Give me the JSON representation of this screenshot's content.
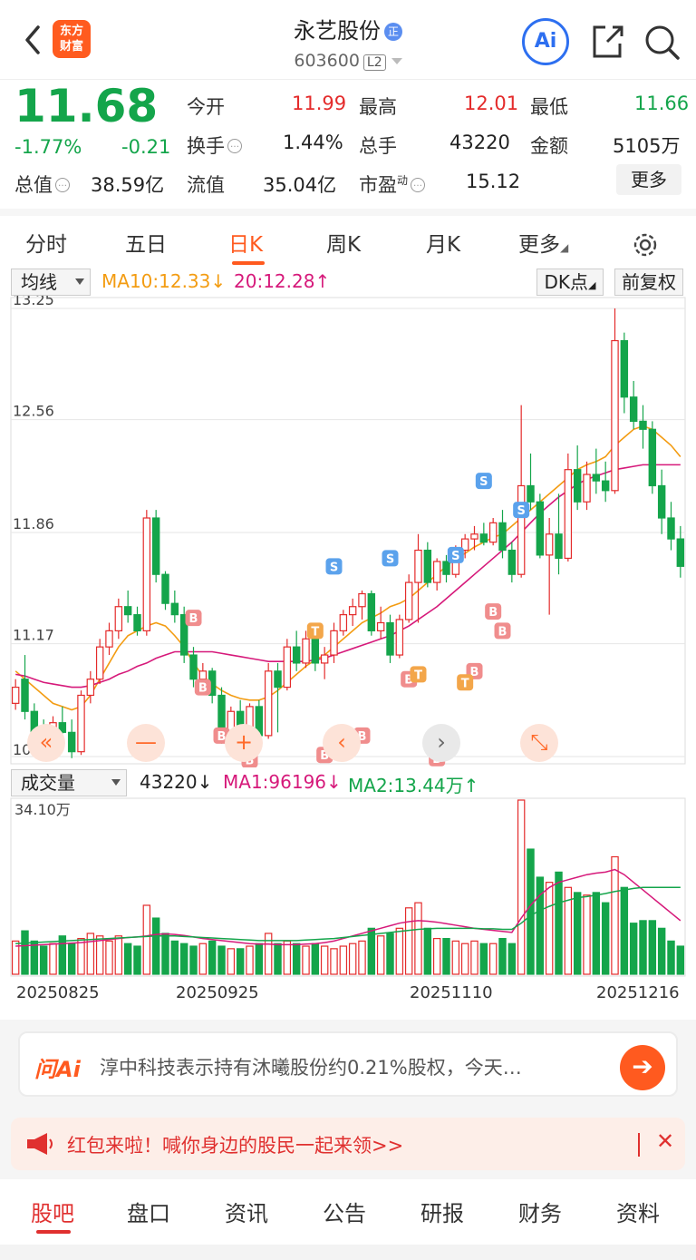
{
  "header": {
    "logo_text": "东方\n财富",
    "title": "永艺股份",
    "title_badge": "正",
    "code": "603600",
    "level": "L2",
    "ai_label": "Ai"
  },
  "quote": {
    "price": "11.68",
    "change_pct": "-1.77%",
    "change_abs": "-0.21",
    "open_label": "今开",
    "open": "11.99",
    "high_label": "最高",
    "high": "12.01",
    "low_label": "最低",
    "low": "11.66",
    "turnover_label": "换手",
    "turnover": "1.44%",
    "volume_label": "总手",
    "volume": "43220",
    "amount_label": "金额",
    "amount": "5105万",
    "mcap_label": "总值",
    "mcap": "38.59亿",
    "float_label": "流值",
    "float_mcap": "35.04亿",
    "pe_label": "市盈",
    "pe_sup": "动",
    "pe": "15.12",
    "more": "更多"
  },
  "tabs": [
    "分时",
    "五日",
    "日K",
    "周K",
    "月K",
    "更多"
  ],
  "active_tab": "日K",
  "kline": {
    "indicator": "均线",
    "ma10": "MA10:12.33↓",
    "ma20": "20:12.28↑",
    "dk_label": "DK点",
    "adjust_label": "前复权",
    "y_ticks": [
      "13.25",
      "12.56",
      "11.86",
      "11.17",
      "10.47"
    ]
  },
  "volume": {
    "indicator": "成交量",
    "value": "43220↓",
    "ma1": "MA1:96196↓",
    "ma2": "MA2:13.44万↑",
    "max_label": "34.10万"
  },
  "dates": [
    "20250825",
    "20250925",
    "20251110",
    "20251216"
  ],
  "controls": [
    "«",
    "—",
    "+",
    "‹",
    "›",
    "⤡"
  ],
  "ai": {
    "logo": "问Ai",
    "text": "淳中科技表示持有沐曦股份约0.21%股权，今天…"
  },
  "promo": {
    "text": "红包来啦！喊你身边的股民一起来领>>"
  },
  "bottom_tabs": [
    "股吧",
    "盘口",
    "资讯",
    "公告",
    "研报",
    "财务",
    "资料"
  ],
  "colors": {
    "up": "#e42b2b",
    "down": "#14a54b",
    "accent": "#ff5a1f",
    "ma10": "#f39c12",
    "ma20": "#d6197a"
  },
  "chart_data": {
    "type": "candlestick",
    "ylim": [
      10.47,
      13.25
    ],
    "y_ticks": [
      13.25,
      12.56,
      11.86,
      11.17,
      10.47
    ],
    "x_labels": [
      "20250825",
      "20250925",
      "20251110",
      "20251216"
    ],
    "candles": [
      [
        10.8,
        10.95,
        10.76,
        10.9
      ],
      [
        10.95,
        11.1,
        10.7,
        10.75
      ],
      [
        10.75,
        10.8,
        10.55,
        10.6
      ],
      [
        10.6,
        10.7,
        10.45,
        10.5
      ],
      [
        10.5,
        10.72,
        10.47,
        10.68
      ],
      [
        10.68,
        10.78,
        10.55,
        10.62
      ],
      [
        10.62,
        10.7,
        10.46,
        10.5
      ],
      [
        10.5,
        10.88,
        10.48,
        10.85
      ],
      [
        10.85,
        11.0,
        10.8,
        10.95
      ],
      [
        10.95,
        11.2,
        10.92,
        11.15
      ],
      [
        11.15,
        11.3,
        11.1,
        11.25
      ],
      [
        11.25,
        11.45,
        11.2,
        11.4
      ],
      [
        11.4,
        11.5,
        11.3,
        11.35
      ],
      [
        11.35,
        11.4,
        11.22,
        11.25
      ],
      [
        11.25,
        12.0,
        11.22,
        11.95
      ],
      [
        11.95,
        12.0,
        11.55,
        11.6
      ],
      [
        11.6,
        11.62,
        11.38,
        11.42
      ],
      [
        11.42,
        11.5,
        11.3,
        11.35
      ],
      [
        11.35,
        11.4,
        11.05,
        11.1
      ],
      [
        11.1,
        11.15,
        10.9,
        10.95
      ],
      [
        10.95,
        11.05,
        10.85,
        11.0
      ],
      [
        11.0,
        11.02,
        10.8,
        10.85
      ],
      [
        10.85,
        10.9,
        10.55,
        10.6
      ],
      [
        10.6,
        10.78,
        10.55,
        10.75
      ],
      [
        10.75,
        10.82,
        10.6,
        10.65
      ],
      [
        10.65,
        10.8,
        10.62,
        10.78
      ],
      [
        10.78,
        10.82,
        10.55,
        10.6
      ],
      [
        10.6,
        11.05,
        10.58,
        11.0
      ],
      [
        11.0,
        11.05,
        10.62,
        10.9
      ],
      [
        10.9,
        11.2,
        10.88,
        11.15
      ],
      [
        11.15,
        11.25,
        11.0,
        11.05
      ],
      [
        11.05,
        11.25,
        11.02,
        11.2
      ],
      [
        11.2,
        11.22,
        11.0,
        11.05
      ],
      [
        11.05,
        11.15,
        10.95,
        11.1
      ],
      [
        11.1,
        11.3,
        11.05,
        11.25
      ],
      [
        11.25,
        11.38,
        11.22,
        11.35
      ],
      [
        11.35,
        11.45,
        11.28,
        11.4
      ],
      [
        11.4,
        11.5,
        11.32,
        11.48
      ],
      [
        11.48,
        11.5,
        11.22,
        11.25
      ],
      [
        11.25,
        11.4,
        11.2,
        11.3
      ],
      [
        11.3,
        11.35,
        11.05,
        11.1
      ],
      [
        11.1,
        11.35,
        11.08,
        11.32
      ],
      [
        11.32,
        11.6,
        11.3,
        11.55
      ],
      [
        11.55,
        11.85,
        11.3,
        11.75
      ],
      [
        11.75,
        11.8,
        11.52,
        11.55
      ],
      [
        11.55,
        11.7,
        11.5,
        11.68
      ],
      [
        11.68,
        11.72,
        11.55,
        11.6
      ],
      [
        11.6,
        11.78,
        11.58,
        11.75
      ],
      [
        11.75,
        11.85,
        11.7,
        11.82
      ],
      [
        11.82,
        11.9,
        11.75,
        11.85
      ],
      [
        11.85,
        11.92,
        11.78,
        11.8
      ],
      [
        11.8,
        11.95,
        11.78,
        11.92
      ],
      [
        11.92,
        12.0,
        11.7,
        11.75
      ],
      [
        11.75,
        11.8,
        11.55,
        11.6
      ],
      [
        11.6,
        12.65,
        11.58,
        12.15
      ],
      [
        12.15,
        12.35,
        12.0,
        12.05
      ],
      [
        12.05,
        12.1,
        11.7,
        11.72
      ],
      [
        11.72,
        11.95,
        11.35,
        11.85
      ],
      [
        11.85,
        12.1,
        11.6,
        11.7
      ],
      [
        11.7,
        12.35,
        11.68,
        12.25
      ],
      [
        12.25,
        12.4,
        12.0,
        12.05
      ],
      [
        12.05,
        12.3,
        12.0,
        12.22
      ],
      [
        12.22,
        12.38,
        12.1,
        12.18
      ],
      [
        12.18,
        12.3,
        12.05,
        12.12
      ],
      [
        12.12,
        13.25,
        12.1,
        13.05
      ],
      [
        13.05,
        13.1,
        12.6,
        12.7
      ],
      [
        12.7,
        12.8,
        12.5,
        12.55
      ],
      [
        12.55,
        12.65,
        12.38,
        12.5
      ],
      [
        12.5,
        12.55,
        12.1,
        12.15
      ],
      [
        12.15,
        12.25,
        11.85,
        11.95
      ],
      [
        11.95,
        12.05,
        11.75,
        11.82
      ],
      [
        11.82,
        11.9,
        11.58,
        11.65
      ]
    ],
    "ma10": [
      11.0,
      10.95,
      10.9,
      10.85,
      10.8,
      10.78,
      10.76,
      10.78,
      10.85,
      10.95,
      11.05,
      11.15,
      11.22,
      11.25,
      11.28,
      11.3,
      11.28,
      11.22,
      11.15,
      11.05,
      10.97,
      10.92,
      10.88,
      10.85,
      10.83,
      10.82,
      10.82,
      10.84,
      10.88,
      10.93,
      10.98,
      11.03,
      11.07,
      11.1,
      11.15,
      11.2,
      11.25,
      11.3,
      11.33,
      11.36,
      11.4,
      11.42,
      11.45,
      11.5,
      11.55,
      11.6,
      11.65,
      11.7,
      11.73,
      11.77,
      11.8,
      11.83,
      11.85,
      11.9,
      11.95,
      12.0,
      12.05,
      12.1,
      12.15,
      12.2,
      12.25,
      12.28,
      12.3,
      12.33,
      12.4,
      12.45,
      12.5,
      12.52,
      12.5,
      12.45,
      12.4,
      12.33
    ],
    "ma20": [
      10.98,
      10.97,
      10.95,
      10.93,
      10.92,
      10.91,
      10.9,
      10.9,
      10.91,
      10.93,
      10.95,
      10.98,
      11.0,
      11.03,
      11.05,
      11.08,
      11.1,
      11.12,
      11.12,
      11.12,
      11.12,
      11.12,
      11.11,
      11.1,
      11.09,
      11.08,
      11.07,
      11.06,
      11.06,
      11.06,
      11.06,
      11.06,
      11.07,
      11.08,
      11.1,
      11.12,
      11.14,
      11.16,
      11.18,
      11.2,
      11.22,
      11.25,
      11.28,
      11.32,
      11.36,
      11.4,
      11.45,
      11.5,
      11.55,
      11.6,
      11.65,
      11.7,
      11.75,
      11.8,
      11.86,
      11.92,
      11.98,
      12.03,
      12.08,
      12.12,
      12.16,
      12.19,
      12.21,
      12.23,
      12.25,
      12.26,
      12.27,
      12.28,
      12.28,
      12.28,
      12.28,
      12.28
    ],
    "volume": [
      6.5,
      8.5,
      6.5,
      5.5,
      6.0,
      7.5,
      6.0,
      7.0,
      8.0,
      7.5,
      6.5,
      7.5,
      6.0,
      5.5,
      13.5,
      11.0,
      8.0,
      6.5,
      6.0,
      5.5,
      6.0,
      6.5,
      5.5,
      5.0,
      5.0,
      5.5,
      6.0,
      8.0,
      6.0,
      6.5,
      6.0,
      5.5,
      6.0,
      5.5,
      5.0,
      5.5,
      6.0,
      6.5,
      9.0,
      7.5,
      8.0,
      9.0,
      13.0,
      14.0,
      9.0,
      7.0,
      7.0,
      6.5,
      6.0,
      6.5,
      6.0,
      6.0,
      7.0,
      6.0,
      34.1,
      24.5,
      19.0,
      18.0,
      20.0,
      17.0,
      16.0,
      15.5,
      16.0,
      14.0,
      23.0,
      17.0,
      10.0,
      10.5,
      10.5,
      9.0,
      6.5,
      5.5
    ],
    "vol_ma1": [
      5.5,
      5.6,
      5.7,
      5.8,
      5.9,
      6.0,
      6.1,
      6.2,
      6.4,
      6.6,
      6.8,
      7.0,
      7.2,
      7.3,
      7.5,
      7.8,
      7.9,
      7.8,
      7.6,
      7.3,
      7.0,
      6.8,
      6.6,
      6.4,
      6.2,
      6.0,
      5.9,
      5.9,
      5.8,
      5.8,
      5.8,
      5.9,
      6.0,
      6.2,
      6.5,
      7.0,
      7.5,
      8.0,
      8.5,
      9.0,
      9.5,
      10.0,
      10.3,
      10.5,
      10.4,
      10.2,
      9.9,
      9.6,
      9.3,
      9.0,
      8.8,
      8.6,
      8.4,
      8.2,
      11.0,
      13.5,
      15.5,
      17.0,
      18.0,
      18.5,
      19.0,
      19.5,
      19.8,
      20.0,
      20.5,
      19.5,
      18.0,
      16.5,
      15.0,
      13.5,
      12.0,
      10.5
    ],
    "vol_ma2": [
      6.0,
      6.1,
      6.2,
      6.3,
      6.4,
      6.5,
      6.6,
      6.7,
      6.8,
      6.9,
      7.0,
      7.1,
      7.2,
      7.3,
      7.4,
      7.5,
      7.5,
      7.5,
      7.4,
      7.3,
      7.2,
      7.1,
      7.0,
      6.9,
      6.8,
      6.7,
      6.6,
      6.6,
      6.6,
      6.6,
      6.6,
      6.7,
      6.8,
      6.9,
      7.0,
      7.2,
      7.4,
      7.6,
      7.8,
      8.0,
      8.2,
      8.4,
      8.6,
      8.8,
      8.9,
      9.0,
      9.0,
      9.0,
      9.0,
      9.0,
      8.9,
      8.9,
      8.8,
      8.8,
      10.0,
      11.5,
      12.5,
      13.3,
      14.0,
      14.5,
      15.0,
      15.2,
      15.5,
      15.8,
      16.2,
      16.5,
      16.8,
      17.0,
      17.0,
      17.0,
      17.0,
      17.0
    ],
    "markers": [
      {
        "label": "B",
        "i": 19,
        "p": 11.33
      },
      {
        "label": "B",
        "i": 20,
        "p": 10.9
      },
      {
        "label": "B",
        "i": 22,
        "p": 10.6
      },
      {
        "label": "B",
        "i": 25,
        "p": 10.45
      },
      {
        "label": "T",
        "i": 32,
        "p": 11.25
      },
      {
        "label": "B",
        "i": 33,
        "p": 10.48
      },
      {
        "label": "S",
        "i": 34,
        "p": 11.65
      },
      {
        "label": "B",
        "i": 37,
        "p": 10.6
      },
      {
        "label": "S",
        "i": 40,
        "p": 11.7
      },
      {
        "label": "B",
        "i": 42,
        "p": 10.95
      },
      {
        "label": "T",
        "i": 43,
        "p": 10.98
      },
      {
        "label": "B",
        "i": 45,
        "p": 10.46
      },
      {
        "label": "S",
        "i": 47,
        "p": 11.72
      },
      {
        "label": "B",
        "i": 49,
        "p": 11.0
      },
      {
        "label": "T",
        "i": 48,
        "p": 10.93
      },
      {
        "label": "S",
        "i": 50,
        "p": 12.18
      },
      {
        "label": "B",
        "i": 51,
        "p": 11.37
      },
      {
        "label": "B",
        "i": 52,
        "p": 11.25
      },
      {
        "label": "S",
        "i": 54,
        "p": 12.0
      }
    ]
  }
}
